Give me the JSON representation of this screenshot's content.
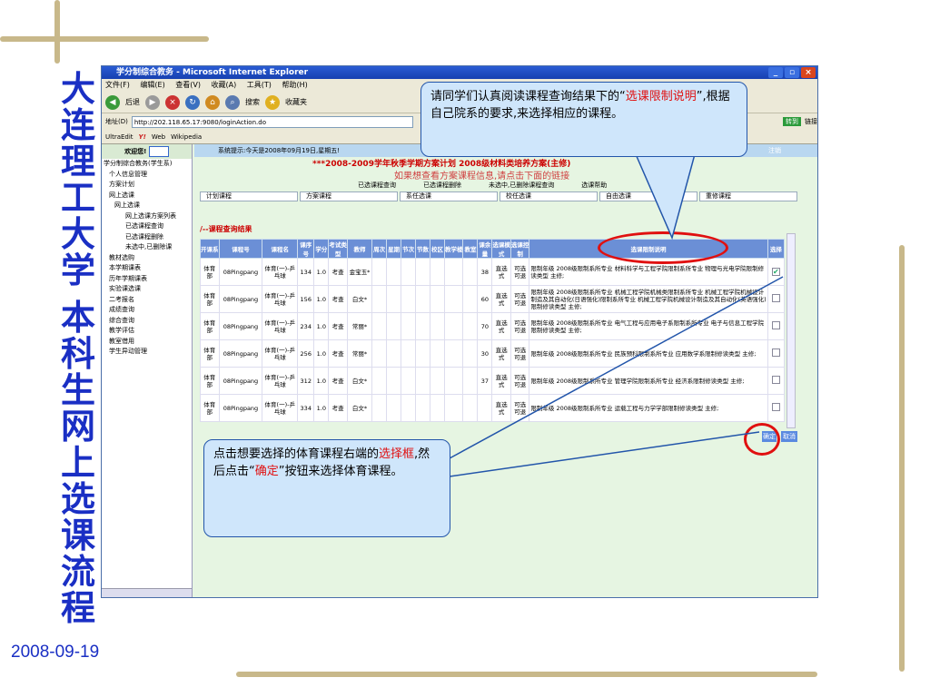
{
  "side_titles": {
    "left1": "大连理工大学",
    "left2": "本科生网上选课流程"
  },
  "date": "2008-09-19",
  "window": {
    "title": "学分制综合教务 - Microsoft Internet Explorer",
    "menu": [
      "文件(F)",
      "编辑(E)",
      "查看(V)",
      "收藏(A)",
      "工具(T)",
      "帮助(H)"
    ],
    "toolbar": [
      "后退",
      "搜索",
      "收藏夹"
    ],
    "address_label": "地址(D)",
    "address": "http://202.118.65.17:9080/loginAction.do",
    "go": "转到",
    "links_label": "链接",
    "links_bar": [
      "UltraEdit",
      "Web",
      "Wikipedia"
    ]
  },
  "nav": {
    "header": "欢迎您!",
    "items": [
      "学分制综合教务(学生系)",
      "个人信息管理",
      "方案计划",
      "网上选课",
      "网上选课",
      "网上选课方案列表",
      "已选课程查询",
      "已选课程删除",
      "未选中,已删除课",
      "教材选购",
      "本学期课表",
      "历年学期课表",
      "实验课选课",
      "二考报名",
      "成绩查询",
      "综合查询",
      "教学评估",
      "教室借用",
      "学生异动管理"
    ]
  },
  "system_tip": "系统提示:今天是2008年09月19日,星期五!",
  "exit": "注销",
  "plan_title": "***2008-2009学年秋季学期方案计划 2008级材料类培养方案(主修)",
  "plan_link": "如果想查看方案课程信息,请点击下面的链接",
  "subnav": [
    "已选课程查询",
    "已选课程删除",
    "未选中,已删除课程查询",
    "选课帮助"
  ],
  "tabs": [
    "计划课程",
    "方案课程",
    "系任选课",
    "校任选课",
    "自由选课",
    "重修课程"
  ],
  "result_title": "/--课程查询结果",
  "headers": [
    "开课系",
    "课程号",
    "课程名",
    "课序号",
    "学分",
    "考试类型",
    "教师",
    "周次",
    "星期",
    "节次",
    "节数",
    "校区",
    "教学楼",
    "教室",
    "课余量",
    "选课模式",
    "选课控制",
    "选课限制说明",
    "选择"
  ],
  "rows": [
    {
      "dept": "体育部",
      "code": "08Pingpang",
      "name": "体育(一)-乒乓球",
      "seq": "134",
      "credit": "1.0",
      "exam": "考查",
      "teacher": "金宝玉*",
      "cap": "38",
      "mode": "直选式",
      "ctrl": "可选可退",
      "rule": "限制年级 2008级限制系所专业 材料科学与工程学院限制系所专业 物理与光电学院限制修读类型 主修;",
      "checked": true
    },
    {
      "dept": "体育部",
      "code": "08Pingpang",
      "name": "体育(一)-乒乓球",
      "seq": "156",
      "credit": "1.0",
      "exam": "考查",
      "teacher": "白文*",
      "cap": "60",
      "mode": "直选式",
      "ctrl": "可选可退",
      "rule": "限制年级 2008级限制系所专业 机械工程学院机械类限制系所专业 机械工程学院机械设计制造及其自动化(日语强化)限制系所专业 机械工程学院机械设计制造及其自动化(英语强化)限制修读类型 主修;",
      "checked": false
    },
    {
      "dept": "体育部",
      "code": "08Pingpang",
      "name": "体育(一)-乒乓球",
      "seq": "234",
      "credit": "1.0",
      "exam": "考查",
      "teacher": "常丽*",
      "cap": "70",
      "mode": "直选式",
      "ctrl": "可选可退",
      "rule": "限制年级 2008级限制系所专业 电气工程与应用电子系限制系所专业 电子与信息工程学院限制修读类型 主修;",
      "checked": false
    },
    {
      "dept": "体育部",
      "code": "08Pingpang",
      "name": "体育(一)-乒乓球",
      "seq": "256",
      "credit": "1.0",
      "exam": "考查",
      "teacher": "常丽*",
      "cap": "30",
      "mode": "直选式",
      "ctrl": "可选可退",
      "rule": "限制年级 2008级限制系所专业 民族预科限制系所专业 应用数学系限制修读类型 主修;",
      "checked": false
    },
    {
      "dept": "体育部",
      "code": "08Pingpang",
      "name": "体育(一)-乒乓球",
      "seq": "312",
      "credit": "1.0",
      "exam": "考查",
      "teacher": "白文*",
      "cap": "37",
      "mode": "直选式",
      "ctrl": "可选可退",
      "rule": "限制年级 2008级限制系所专业 管理学院限制系所专业 经济系限制修读类型 主修;",
      "checked": false
    },
    {
      "dept": "体育部",
      "code": "08Pingpang",
      "name": "体育(一)-乒乓球",
      "seq": "334",
      "credit": "1.0",
      "exam": "考查",
      "teacher": "白文*",
      "cap": "",
      "mode": "直选式",
      "ctrl": "可选可退",
      "rule": "限制年级 2008级限制系所专业 运载工程与力学学部限制修读类型 主修;",
      "checked": false
    }
  ],
  "buttons": {
    "confirm": "确定",
    "cancel": "取消"
  },
  "callout1": {
    "a": "请同学们认真阅读课程查询结果下的“",
    "b": "选课限制说明",
    "c": "”,根据自己院系的要求,来选择相应的课程。"
  },
  "callout2": {
    "a": "点击想要选择的体育课程右端的",
    "b": "选择框",
    "c": ",然后点击“",
    "d": "确定",
    "e": "”按钮来选择体育课程。"
  }
}
